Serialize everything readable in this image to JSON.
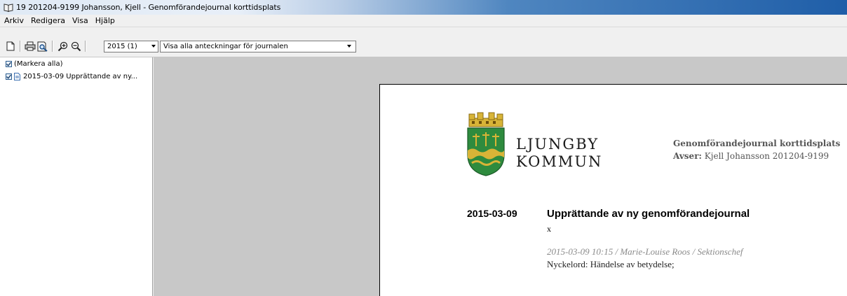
{
  "window": {
    "title": "19 201204-9199 Johansson, Kjell - Genomförandejournal korttidsplats",
    "icon": "book-icon"
  },
  "menu": {
    "items": [
      "Arkiv",
      "Redigera",
      "Visa",
      "Hjälp"
    ]
  },
  "toolbar": {
    "buttons": [
      "new-document-icon",
      "print-icon",
      "print-preview-icon",
      "zoom-in-icon",
      "zoom-out-icon"
    ],
    "year_select": {
      "value": "2015 (1)"
    },
    "filter_select": {
      "value": "Visa alla anteckningar för journalen"
    }
  },
  "tree": {
    "items": [
      {
        "label": "(Markera alla)",
        "checked": true
      },
      {
        "label": "2015-03-09 Upprättande av ny...",
        "checked": true
      }
    ]
  },
  "document": {
    "logo_line1": "LJUNGBY",
    "logo_line2": "KOMMUN",
    "doc_type": "Genomförandejournal korttidsplats",
    "avser_label": "Avser:",
    "avser_value": "Kjell Johansson 201204-9199",
    "entry": {
      "date": "2015-03-09",
      "heading": "Upprättande av ny genomförandejournal",
      "body": "x",
      "meta": "2015-03-09 10:15 / Marie-Louise Roos / Sektionschef",
      "keywords": "Nyckelord: Händelse av betydelse;"
    }
  },
  "colors": {
    "crest_green": "#2e8b3e",
    "crest_gold": "#d8b437",
    "viewer_bg": "#c8c8c8"
  }
}
